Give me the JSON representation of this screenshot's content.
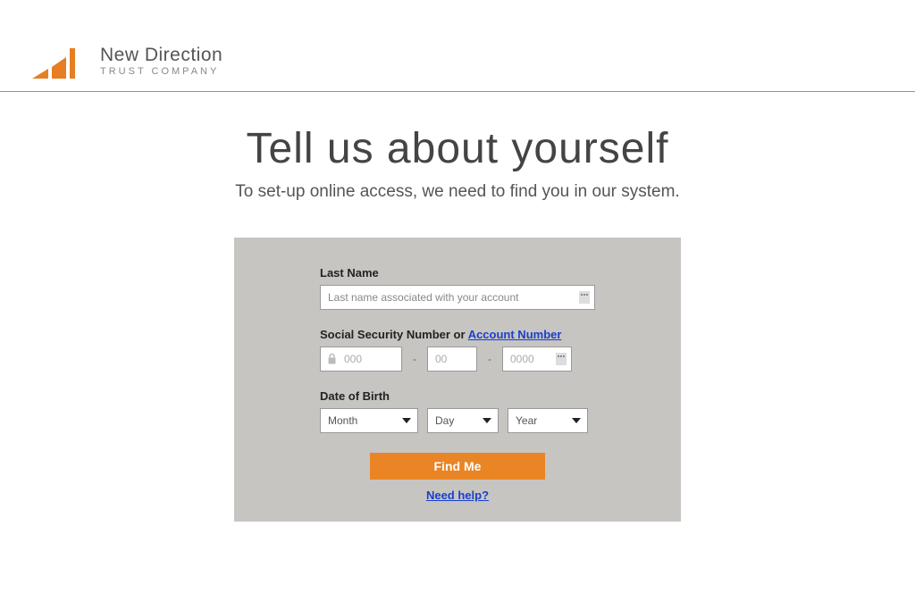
{
  "brand": {
    "main": "New Direction",
    "sub": "TRUST COMPANY"
  },
  "page": {
    "title": "Tell us about yourself",
    "subtitle": "To set-up online access, we need to find you in our system."
  },
  "form": {
    "lastname_label": "Last Name",
    "lastname_placeholder": "Last name associated with your account",
    "ssn_label_prefix": "Social Security Number or ",
    "account_number_link": "Account Number",
    "ssn": {
      "p1": "000",
      "p2": "00",
      "p3": "0000",
      "sep": "-"
    },
    "dob_label": "Date of Birth",
    "dob": {
      "month": "Month",
      "day": "Day",
      "year": "Year"
    },
    "submit": "Find Me",
    "help": "Need help?"
  }
}
